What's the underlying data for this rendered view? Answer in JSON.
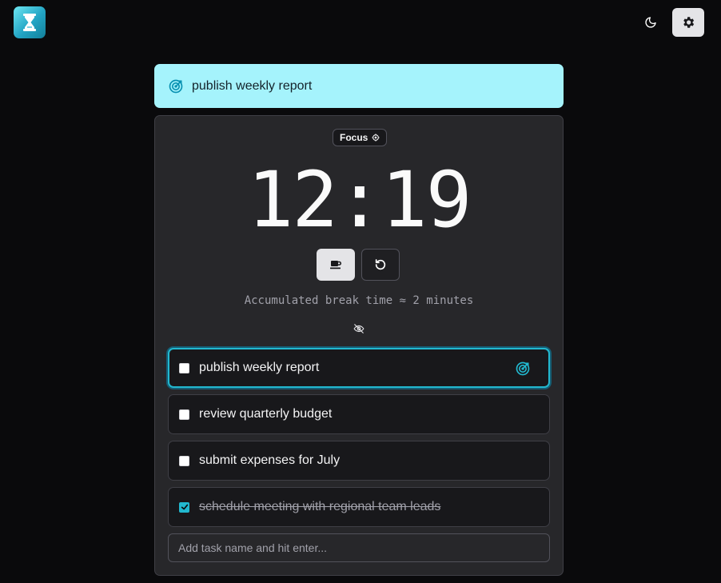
{
  "header": {
    "logo_icon": "hourglass-icon",
    "theme_icon": "moon-icon",
    "settings_icon": "gear-icon"
  },
  "current_task": {
    "icon": "target-icon",
    "label": "publish weekly report"
  },
  "timer": {
    "mode": "Focus",
    "mode_icon": "target-small-icon",
    "time": "12:19",
    "break_info": "Accumulated break time ≈ 2 minutes",
    "controls": {
      "break_icon": "coffee-icon",
      "reset_icon": "reset-icon",
      "hide_icon": "eye-off-icon"
    }
  },
  "tasks": [
    {
      "label": "publish weekly report",
      "done": false,
      "active": true
    },
    {
      "label": "review quarterly budget",
      "done": false,
      "active": false
    },
    {
      "label": "submit expenses for July",
      "done": false,
      "active": false
    },
    {
      "label": "schedule meeting with regional team leads",
      "done": true,
      "active": false
    }
  ],
  "add_task": {
    "placeholder": "Add task name and hit enter...",
    "value": ""
  },
  "colors": {
    "accent": "#22b8cf",
    "banner": "#a5f3fc",
    "background": "#0a0a0c",
    "card": "#27272a"
  }
}
